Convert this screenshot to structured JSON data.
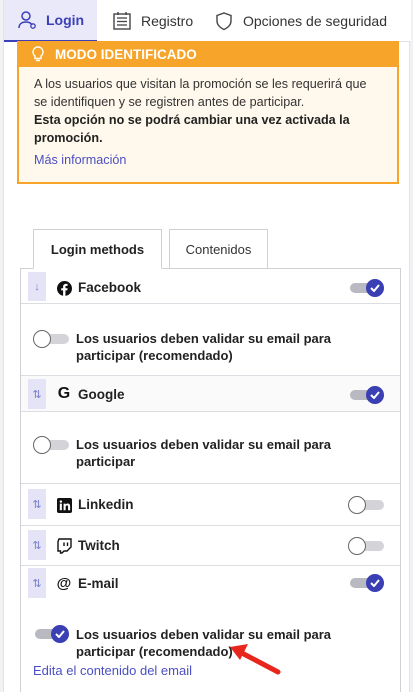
{
  "top_tabs": [
    {
      "label": "Login",
      "icon": "user-icon"
    },
    {
      "label": "Registro",
      "icon": "form-icon"
    },
    {
      "label": "Opciones de seguridad",
      "icon": "shield-icon"
    }
  ],
  "warning": {
    "title": "MODO IDENTIFICADO",
    "text": "A los usuarios que visitan la promoción se les requerirá que se identifiquen y se registren antes de participar.",
    "bold_text": "Esta opción no se podrá cambiar una vez activada la promoción.",
    "link": "Más información"
  },
  "inner_tabs": {
    "active": "Login methods",
    "other": "Contenidos"
  },
  "methods": [
    {
      "label": "Facebook",
      "icon": "facebook-icon",
      "enabled": true,
      "validate_label": "Los usuarios deben validar su email para participar (recomendado)",
      "validate": false
    },
    {
      "label": "Google",
      "icon": "google-icon",
      "enabled": true,
      "validate_label": "Los usuarios deben validar su email para participar",
      "validate": false
    },
    {
      "label": "Linkedin",
      "icon": "linkedin-icon",
      "enabled": false
    },
    {
      "label": "Twitch",
      "icon": "twitch-icon",
      "enabled": false
    },
    {
      "label": "E-mail",
      "icon": "at-icon",
      "enabled": true,
      "validate_label": "Los usuarios deben validar su email para participar (recomendado)",
      "validate": true,
      "edit_link": "Edita el contenido del email"
    }
  ],
  "colors": {
    "accent": "#3a3fb3",
    "warning": "#f6a52a",
    "annotation": "#e8261c"
  }
}
